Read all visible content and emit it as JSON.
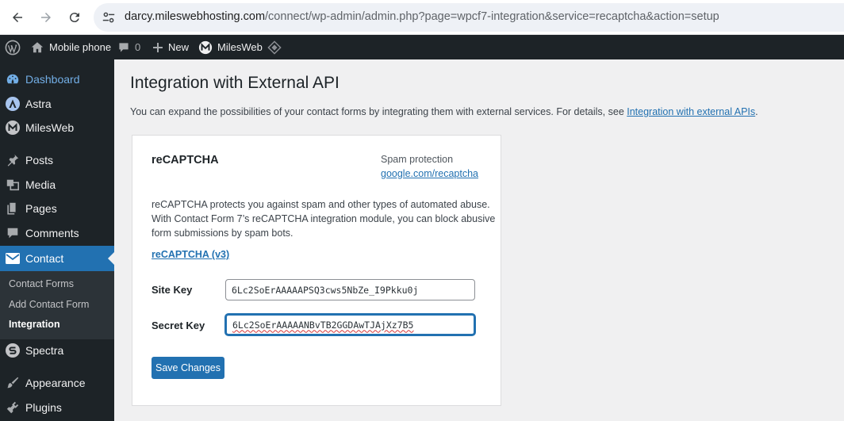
{
  "browser": {
    "url_host": "darcy.mileswebhosting.com",
    "url_path": "/connect/wp-admin/admin.php?page=wpcf7-integration&service=recaptcha&action=setup"
  },
  "admin_bar": {
    "site_name": "Mobile phone",
    "comments_count": "0",
    "new_label": "New",
    "milesweb_label": "MilesWeb"
  },
  "sidebar": {
    "items": [
      {
        "label": "Dashboard",
        "icon": "dashboard-icon"
      },
      {
        "label": "Astra",
        "icon": "astra-icon"
      },
      {
        "label": "MilesWeb",
        "icon": "milesweb-icon"
      },
      {
        "label": "Posts",
        "icon": "pin-icon"
      },
      {
        "label": "Media",
        "icon": "media-icon"
      },
      {
        "label": "Pages",
        "icon": "pages-icon"
      },
      {
        "label": "Comments",
        "icon": "comment-icon"
      },
      {
        "label": "Contact",
        "icon": "mail-icon"
      },
      {
        "label": "Spectra",
        "icon": "spectra-icon"
      },
      {
        "label": "Appearance",
        "icon": "brush-icon"
      },
      {
        "label": "Plugins",
        "icon": "plugin-icon"
      }
    ],
    "submenu": [
      "Contact Forms",
      "Add Contact Form",
      "Integration"
    ]
  },
  "main": {
    "title": "Integration with External API",
    "intro_text": "You can expand the possibilities of your contact forms by integrating them with external services. For details, see ",
    "intro_link": "Integration with external APIs",
    "intro_end": "."
  },
  "card": {
    "title": "reCAPTCHA",
    "category": "Spam protection",
    "site_link": "google.com/recaptcha",
    "desc_lines": [
      "reCAPTCHA protects you against spam and other types of automated abuse.",
      "With Contact Form 7’s reCAPTCHA integration module, you can block abusive",
      "form submissions by spam bots."
    ],
    "version_link": "reCAPTCHA (v3)",
    "site_key_label": "Site Key",
    "site_key_value": "6Lc2SoErAAAAAPSQ3cws5NbZe_I9Pkku0j",
    "secret_key_label": "Secret Key",
    "secret_key_value": "6Lc2SoErAAAAANBvTB2GGDAwTJAjXz7B5",
    "save_label": "Save Changes"
  },
  "colors": {
    "admin_dark": "#1d2327",
    "accent": "#2271b1",
    "submenu_bg": "#2c3338",
    "page_bg": "#f0f0f1"
  }
}
